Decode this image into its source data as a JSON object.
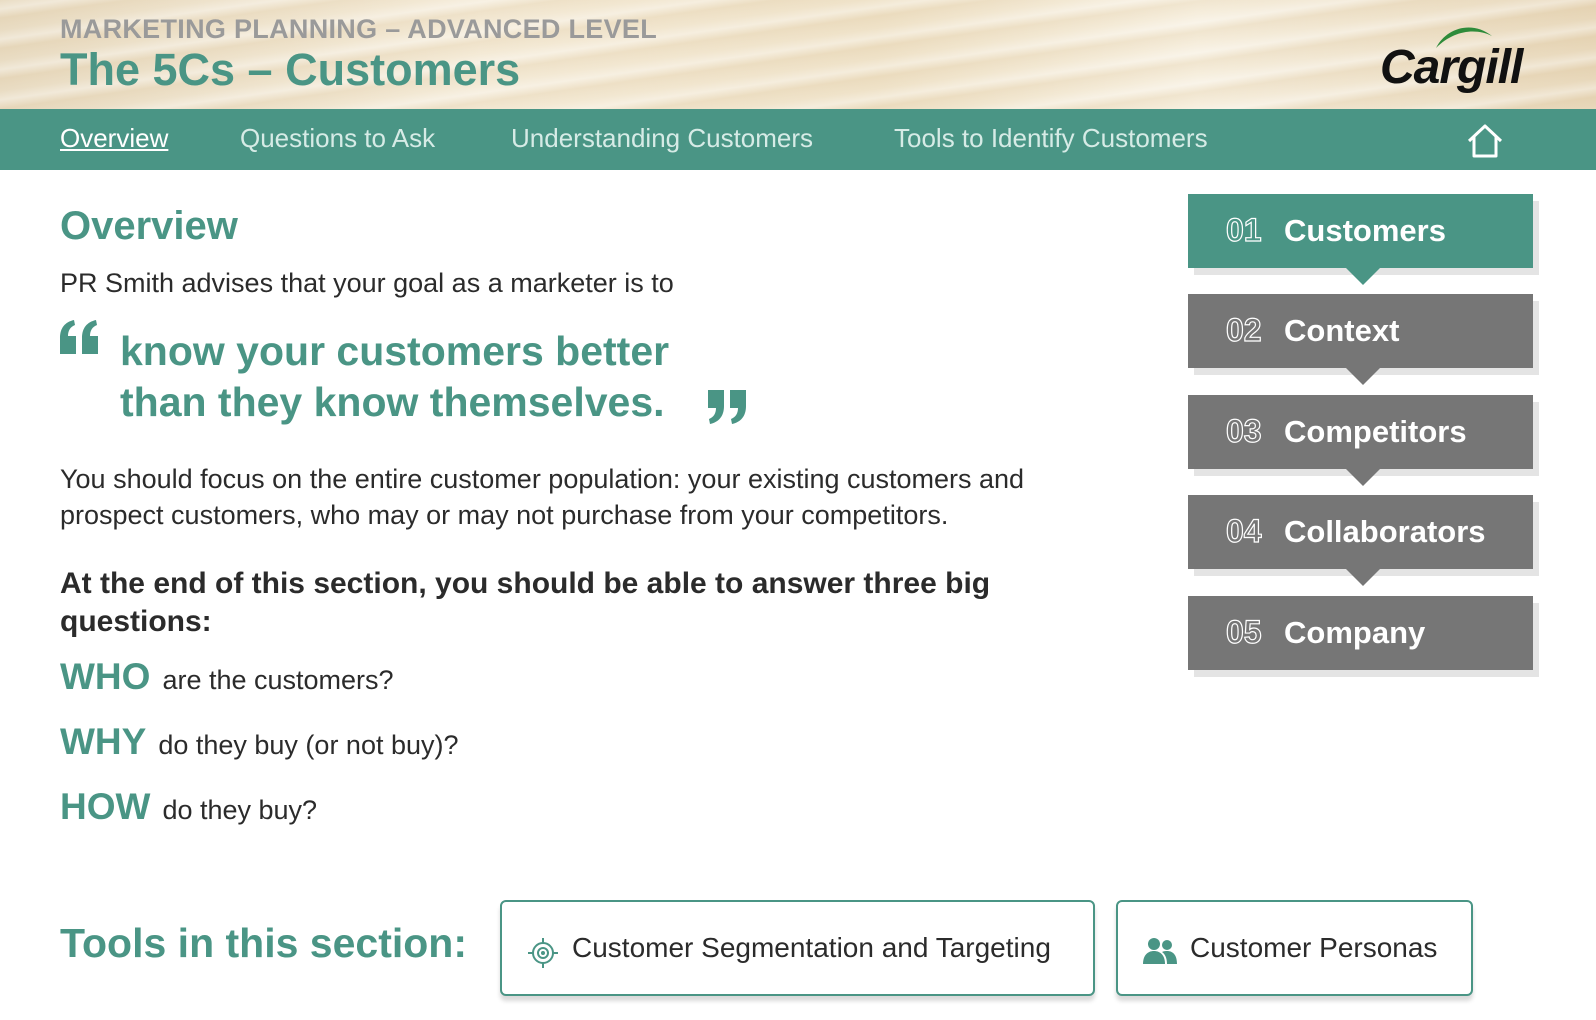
{
  "header": {
    "supertitle": "MARKETING PLANNING – ADVANCED LEVEL",
    "title": "The 5Cs – Customers",
    "logo_text": "Cargill",
    "logo_color": "#2e8b3a"
  },
  "nav": {
    "items": [
      {
        "label": "Overview",
        "active": true
      },
      {
        "label": "Questions to Ask",
        "active": false
      },
      {
        "label": "Understanding Customers",
        "active": false
      },
      {
        "label": "Tools to Identify Customers",
        "active": false
      }
    ],
    "home_icon": "home-icon"
  },
  "content": {
    "heading": "Overview",
    "intro": "PR Smith advises that your goal as a marketer is to",
    "quote_line1": "know your customers better",
    "quote_line2": "than they know themselves.",
    "paragraph": "You should focus on the entire customer population: your existing customers and prospect customers, who may or may not purchase from your competitors.",
    "questions_intro": "At the end of this section, you should be able to answer three big questions:",
    "questions": [
      {
        "keyword": "WHO",
        "text": "are the customers?"
      },
      {
        "keyword": "WHY",
        "text": "do they buy (or not buy)?"
      },
      {
        "keyword": "HOW",
        "text": "do they buy?"
      }
    ]
  },
  "sections": [
    {
      "number": "01",
      "label": "Customers",
      "active": true
    },
    {
      "number": "02",
      "label": "Context",
      "active": false
    },
    {
      "number": "03",
      "label": "Competitors",
      "active": false
    },
    {
      "number": "04",
      "label": "Collaborators",
      "active": false
    },
    {
      "number": "05",
      "label": "Company",
      "active": false
    }
  ],
  "tools": {
    "heading": "Tools in this section:",
    "items": [
      {
        "label": "Customer Segmentation and Targeting",
        "icon": "target-icon"
      },
      {
        "label": "Customer Personas",
        "icon": "people-icon"
      }
    ]
  },
  "colors": {
    "accent": "#4a9585",
    "inactive_card": "#767676",
    "subtitle_gray": "#9a9a9a"
  }
}
